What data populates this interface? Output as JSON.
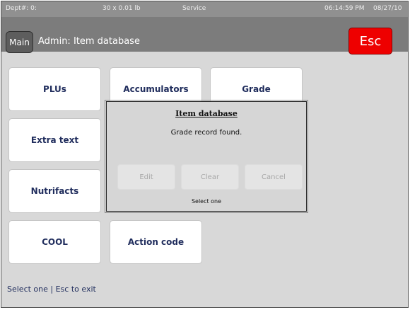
{
  "status_bar": {
    "dept": "Dept#: 0:",
    "scale": "30 x 0.01 lb",
    "mode": "Service",
    "time": "06:14:59 PM",
    "date": "08/27/10"
  },
  "header": {
    "main_label": "Main",
    "title": "Admin: Item database",
    "esc_label": "Esc"
  },
  "tiles": {
    "plus": "PLUs",
    "accumulators": "Accumulators",
    "grade": "Grade",
    "extra_text": "Extra text",
    "nutrifacts": "Nutrifacts",
    "cool": "COOL",
    "action_code": "Action code"
  },
  "dialog": {
    "title": "Item database",
    "message": "Grade record found.",
    "edit_label": "Edit",
    "clear_label": "Clear",
    "cancel_label": "Cancel",
    "hint": "Select one"
  },
  "footer": {
    "text": "Select one | Esc to exit"
  },
  "colors": {
    "esc_button": "#ee0000",
    "tile_text": "#1f2c5c",
    "header_bg": "#7c7c7c",
    "status_bg": "#909090"
  }
}
